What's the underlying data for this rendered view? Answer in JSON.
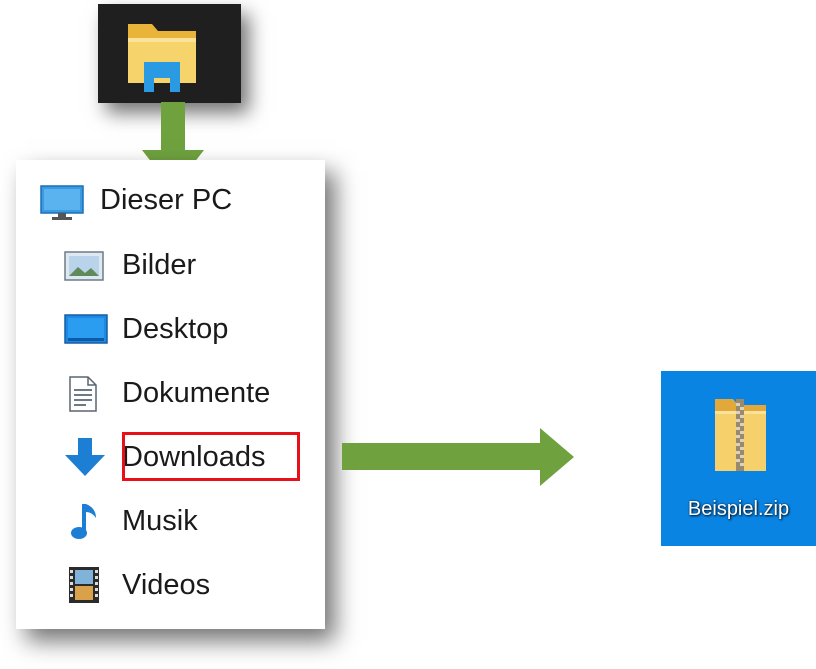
{
  "nav_pane": {
    "root": {
      "label": "Dieser PC",
      "icon": "monitor-icon"
    },
    "items": [
      {
        "label": "Bilder",
        "icon": "pictures-icon"
      },
      {
        "label": "Desktop",
        "icon": "desktop-icon"
      },
      {
        "label": "Dokumente",
        "icon": "documents-icon"
      },
      {
        "label": "Downloads",
        "icon": "download-arrow-icon",
        "highlighted": true
      },
      {
        "label": "Musik",
        "icon": "music-note-icon"
      },
      {
        "label": "Videos",
        "icon": "film-strip-icon"
      }
    ]
  },
  "taskbar": {
    "icon": "file-explorer-icon"
  },
  "desktop": {
    "file_label": "Beispiel.zip",
    "icon": "zip-folder-icon"
  },
  "colors": {
    "arrow": "#6fa23f",
    "highlight": "#e8111a",
    "desktop_background": "#0a84e3",
    "taskbar_background": "#1f1f1f"
  }
}
